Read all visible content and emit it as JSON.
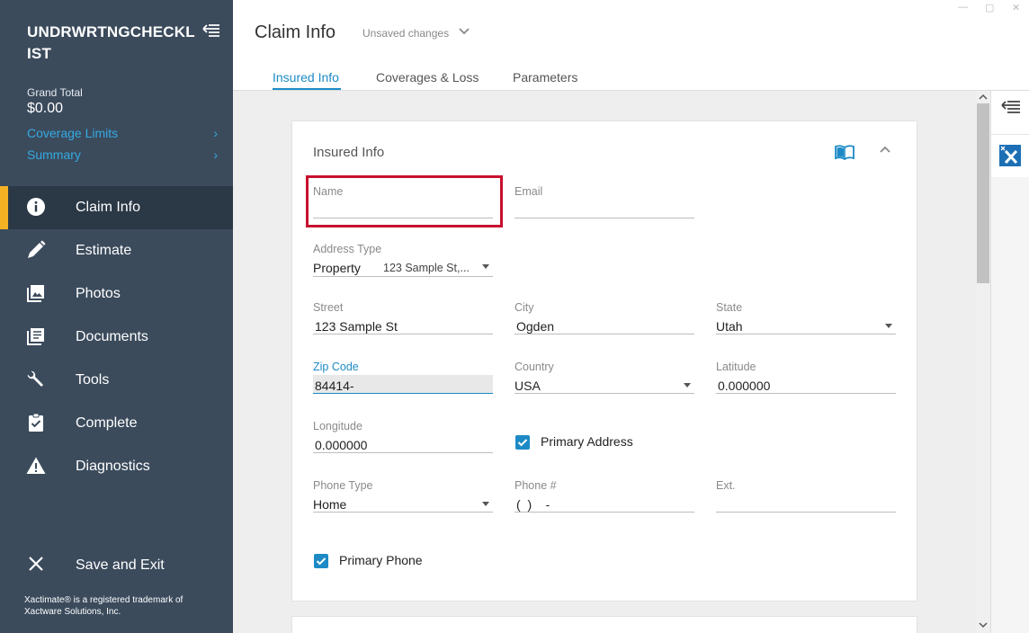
{
  "sidebar": {
    "title": "UNDRWRTNGCHECKLIST",
    "grand_total_label": "Grand Total",
    "grand_total_value": "$0.00",
    "links": [
      {
        "label": "Coverage Limits",
        "chevron": "›"
      },
      {
        "label": "Summary",
        "chevron": "›"
      }
    ],
    "nav": [
      {
        "label": "Claim Info",
        "icon": "info-icon",
        "active": true
      },
      {
        "label": "Estimate",
        "icon": "pencil-icon"
      },
      {
        "label": "Photos",
        "icon": "photos-icon"
      },
      {
        "label": "Documents",
        "icon": "documents-icon"
      },
      {
        "label": "Tools",
        "icon": "wrench-icon"
      },
      {
        "label": "Complete",
        "icon": "clipboard-check-icon"
      },
      {
        "label": "Diagnostics",
        "icon": "warning-icon"
      }
    ],
    "save_exit": "Save and Exit",
    "trademark": "Xactimate® is a registered trademark of Xactware Solutions, Inc."
  },
  "header": {
    "title": "Claim Info",
    "status": "Unsaved changes",
    "tabs": [
      {
        "label": "Insured Info",
        "active": true
      },
      {
        "label": "Coverages & Loss"
      },
      {
        "label": "Parameters"
      }
    ]
  },
  "card": {
    "title": "Insured Info",
    "fields": {
      "name": {
        "label": "Name",
        "value": ""
      },
      "email": {
        "label": "Email",
        "value": ""
      },
      "address_type": {
        "label": "Address Type",
        "value": "Property",
        "secondary": "123 Sample St,..."
      },
      "street": {
        "label": "Street",
        "value": "123 Sample St"
      },
      "city": {
        "label": "City",
        "value": "Ogden"
      },
      "state": {
        "label": "State",
        "value": "Utah"
      },
      "zip": {
        "label": "Zip Code",
        "value": "84414-"
      },
      "country": {
        "label": "Country",
        "value": "USA"
      },
      "latitude": {
        "label": "Latitude",
        "value": "0.000000"
      },
      "longitude": {
        "label": "Longitude",
        "value": "0.000000"
      },
      "phone_type": {
        "label": "Phone Type",
        "value": "Home"
      },
      "phone": {
        "label": "Phone #",
        "value": "(  )    -"
      },
      "ext": {
        "label": "Ext.",
        "value": ""
      }
    },
    "primary_address": {
      "label": "Primary Address",
      "checked": true
    },
    "primary_phone": {
      "label": "Primary Phone",
      "checked": true
    }
  },
  "colors": {
    "sidebar_bg": "#3b4b5c",
    "active_nav_bg": "#2b3846",
    "active_marker": "#f5b324",
    "accent": "#1d8ac6",
    "link": "#36a9e1",
    "highlight": "#c8102e"
  }
}
